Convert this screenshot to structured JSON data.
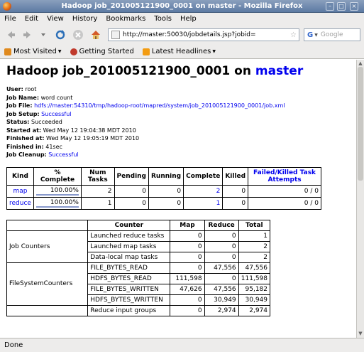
{
  "window": {
    "title": "Hadoop job_201005121900_0001 on master - Mozilla Firefox",
    "minimize_glyph": "–",
    "maximize_glyph": "□",
    "close_glyph": "×"
  },
  "menu": [
    "File",
    "Edit",
    "View",
    "History",
    "Bookmarks",
    "Tools",
    "Help"
  ],
  "nav": {
    "url": "http://master:50030/jobdetails.jsp?jobid=",
    "search_placeholder": "Google",
    "search_engine": "G"
  },
  "bookmarks": [
    {
      "label": "Most Visited",
      "icon": "most-visited-icon",
      "color": "#e08a1e"
    },
    {
      "label": "Getting Started",
      "icon": "firefox-icon",
      "color": "#c0392b"
    },
    {
      "label": "Latest Headlines",
      "icon": "rss-icon",
      "color": "#f39c12"
    }
  ],
  "page": {
    "title_prefix": "Hadoop job_201005121900_0001 on ",
    "title_link": "master",
    "info": [
      {
        "label": "User:",
        "value": "root"
      },
      {
        "label": "Job Name:",
        "value": "word count"
      },
      {
        "label": "Job File:",
        "value": "hdfs://master:54310/tmp/hadoop-root/mapred/system/job_201005121900_0001/job.xml",
        "link": true
      },
      {
        "label": "Job Setup:",
        "value": "Successful",
        "link": true
      },
      {
        "label": "Status:",
        "value": "Succeeded"
      },
      {
        "label": "Started at:",
        "value": "Wed May 12 19:04:38 MDT 2010"
      },
      {
        "label": "Finished at:",
        "value": "Wed May 12 19:05:19 MDT 2010"
      },
      {
        "label": "Finished in:",
        "value": "41sec"
      },
      {
        "label": "Job Cleanup:",
        "value": "Successful",
        "link": true
      }
    ]
  },
  "tasks_table": {
    "headers": [
      "Kind",
      "% Complete",
      "Num Tasks",
      "Pending",
      "Running",
      "Complete",
      "Killed",
      "Failed/Killed Task Attempts"
    ],
    "rows": [
      {
        "kind": "map",
        "complete_pct": "100.00%",
        "num_tasks": "2",
        "pending": "0",
        "running": "0",
        "complete": "2",
        "killed": "0",
        "failed": "0 / 0"
      },
      {
        "kind": "reduce",
        "complete_pct": "100.00%",
        "num_tasks": "1",
        "pending": "0",
        "running": "0",
        "complete": "1",
        "killed": "0",
        "failed": "0 / 0"
      }
    ]
  },
  "counters_table": {
    "headers": [
      "",
      "Counter",
      "Map",
      "Reduce",
      "Total"
    ],
    "groups": [
      {
        "name": "Job Counters",
        "rows": [
          {
            "counter": "Launched reduce tasks",
            "map": "0",
            "reduce": "0",
            "total": "1"
          },
          {
            "counter": "Launched map tasks",
            "map": "0",
            "reduce": "0",
            "total": "2"
          },
          {
            "counter": "Data-local map tasks",
            "map": "0",
            "reduce": "0",
            "total": "2"
          }
        ]
      },
      {
        "name": "FileSystemCounters",
        "rows": [
          {
            "counter": "FILE_BYTES_READ",
            "map": "0",
            "reduce": "47,556",
            "total": "47,556"
          },
          {
            "counter": "HDFS_BYTES_READ",
            "map": "111,598",
            "reduce": "0",
            "total": "111,598"
          },
          {
            "counter": "FILE_BYTES_WRITTEN",
            "map": "47,626",
            "reduce": "47,556",
            "total": "95,182"
          },
          {
            "counter": "HDFS_BYTES_WRITTEN",
            "map": "0",
            "reduce": "30,949",
            "total": "30,949"
          }
        ]
      },
      {
        "name": "",
        "rows": [
          {
            "counter": "Reduce input groups",
            "map": "0",
            "reduce": "2,974",
            "total": "2,974"
          }
        ]
      }
    ]
  },
  "status": "Done"
}
